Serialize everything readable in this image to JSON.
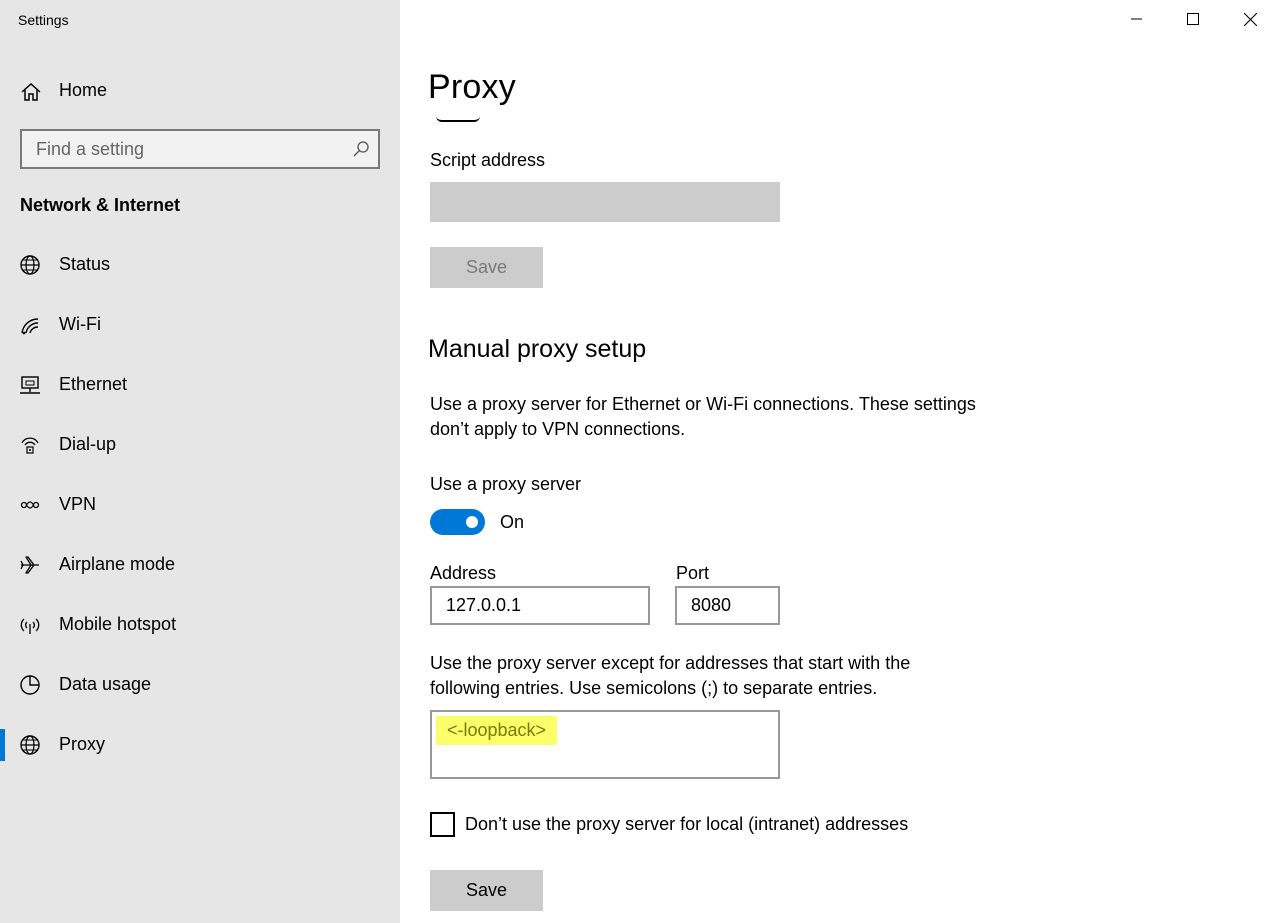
{
  "window": {
    "title": "Settings",
    "controls": {
      "minimize": "minimize",
      "maximize": "maximize",
      "close": "close"
    }
  },
  "sidebar": {
    "home_label": "Home",
    "search_placeholder": "Find a setting",
    "section_title": "Network & Internet",
    "items": [
      {
        "label": "Status",
        "icon": "globe-status-icon"
      },
      {
        "label": "Wi-Fi",
        "icon": "wifi-icon"
      },
      {
        "label": "Ethernet",
        "icon": "ethernet-icon"
      },
      {
        "label": "Dial-up",
        "icon": "dialup-icon"
      },
      {
        "label": "VPN",
        "icon": "vpn-icon"
      },
      {
        "label": "Airplane mode",
        "icon": "airplane-icon"
      },
      {
        "label": "Mobile hotspot",
        "icon": "hotspot-icon"
      },
      {
        "label": "Data usage",
        "icon": "data-usage-icon"
      },
      {
        "label": "Proxy",
        "icon": "globe-icon",
        "active": true
      }
    ],
    "accent_color": "#0078d7"
  },
  "main": {
    "title": "Proxy",
    "script_address_label": "Script address",
    "script_address_value": "",
    "script_save_label": "Save",
    "manual_heading": "Manual proxy setup",
    "manual_description_line1": "Use a proxy server for Ethernet or Wi-Fi connections. These settings",
    "manual_description_line2": "don’t apply to VPN connections.",
    "use_proxy_label": "Use a proxy server",
    "use_proxy_state": "On",
    "use_proxy_enabled": true,
    "address_label": "Address",
    "address_value": "127.0.0.1",
    "port_label": "Port",
    "port_value": "8080",
    "exceptions_desc_line1": "Use the proxy server except for addresses that start with the",
    "exceptions_desc_line2": "following entries. Use semicolons (;) to separate entries.",
    "exceptions_value": "<-loopback>",
    "local_checkbox_label": "Don’t use the proxy server for local (intranet) addresses",
    "local_checkbox_checked": false,
    "save_label": "Save"
  }
}
